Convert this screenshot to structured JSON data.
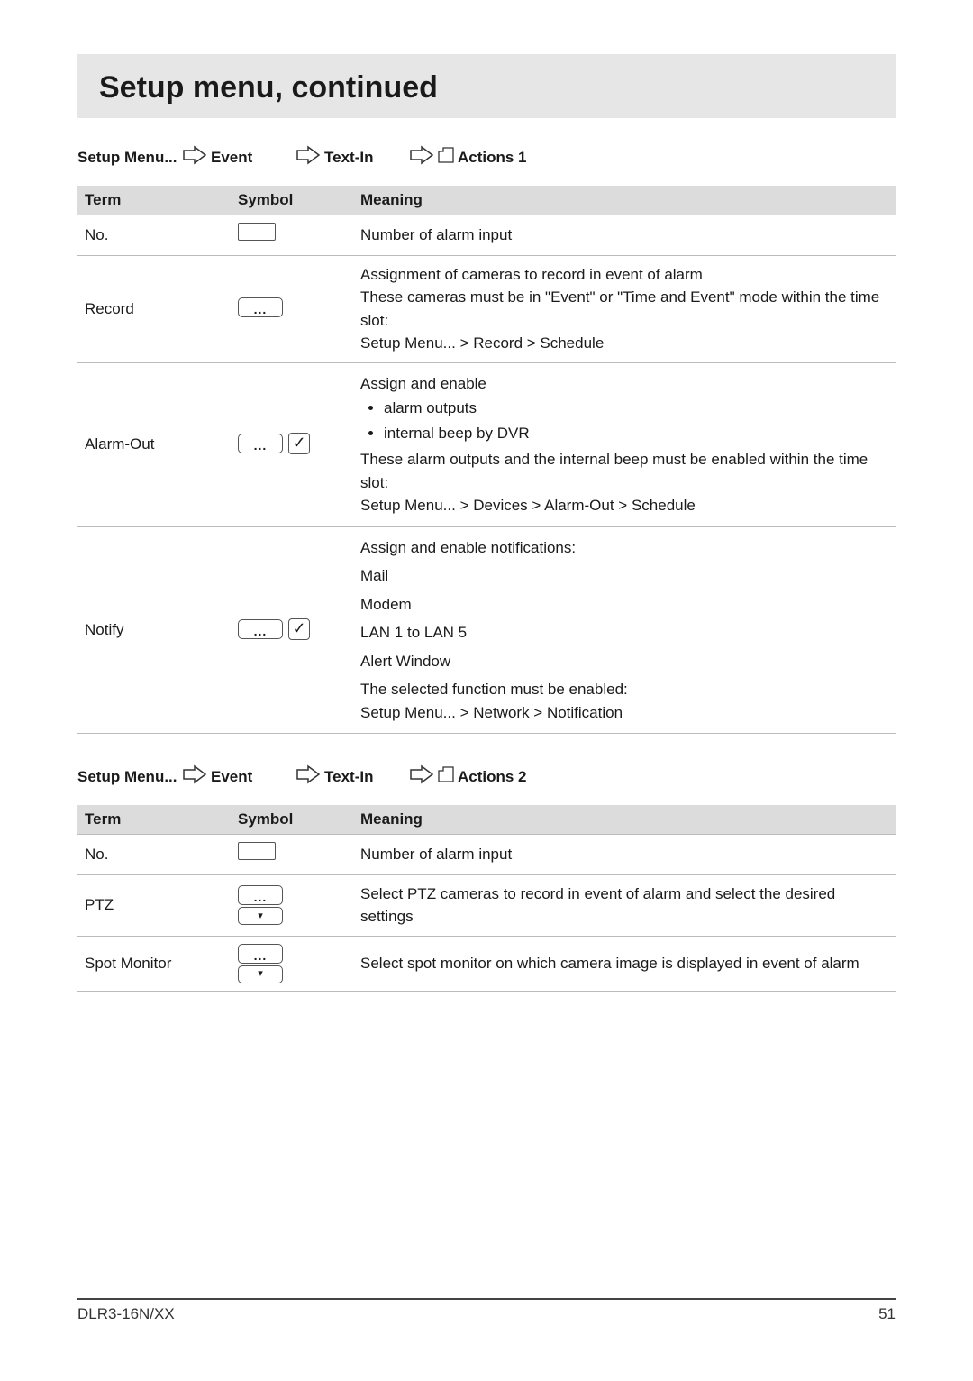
{
  "page_title": "Setup menu, continued",
  "breadcrumb": {
    "root": "Setup Menu...",
    "level1": "Event",
    "level2": "Text-In"
  },
  "sections": [
    {
      "tab_label": "Actions 1",
      "headers": {
        "term": "Term",
        "symbol": "Symbol",
        "meaning": "Meaning"
      },
      "rows": [
        {
          "term": "No.",
          "symbol": "rect",
          "meaning_text": "Number of alarm input"
        },
        {
          "term": "Record",
          "symbol": "ellipsis",
          "meaning_lines": [
            "Assignment of cameras to record in event of alarm",
            "These cameras must be in \"Event\" or \"Time and Event\" mode within the time slot:",
            "Setup Menu... > Record > Schedule"
          ]
        },
        {
          "term": "Alarm-Out",
          "symbol": "ellipsis_check",
          "meaning_intro": "Assign and enable",
          "meaning_bullets": [
            "alarm outputs",
            "internal beep by DVR"
          ],
          "meaning_tail": [
            "These alarm outputs and the internal beep must be enabled within the time slot:",
            "Setup Menu... > Devices > Alarm-Out > Schedule"
          ]
        },
        {
          "term": "Notify",
          "symbol": "ellipsis_check",
          "meaning_lines": [
            "Assign and enable notifications:",
            "Mail",
            "Modem",
            "LAN 1 to LAN 5",
            "Alert Window",
            "The selected function must be enabled:",
            "Setup Menu... > Network > Notification"
          ]
        }
      ]
    },
    {
      "tab_label": "Actions 2",
      "headers": {
        "term": "Term",
        "symbol": "Symbol",
        "meaning": "Meaning"
      },
      "rows": [
        {
          "term": "No.",
          "symbol": "rect",
          "meaning_text": "Number of alarm input"
        },
        {
          "term": "PTZ",
          "symbol": "ellipsis_drop",
          "meaning_text": "Select PTZ cameras to record in event of alarm and select the desired settings"
        },
        {
          "term": "Spot Monitor",
          "symbol": "ellipsis_drop",
          "meaning_text": "Select spot monitor on which camera image is displayed in event of alarm"
        }
      ]
    }
  ],
  "footer": {
    "model": "DLR3-16N/XX",
    "page_no": "51"
  },
  "glyphs": {
    "ellipsis": "...",
    "check": "✓",
    "caret": "▾"
  }
}
